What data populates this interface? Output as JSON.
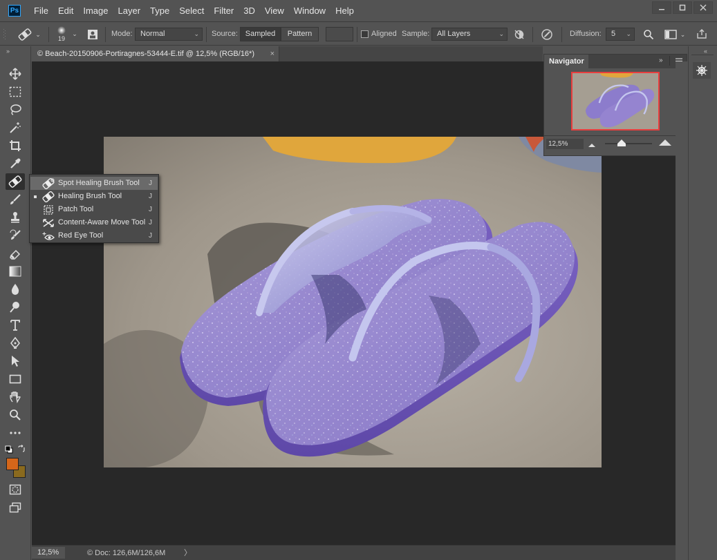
{
  "app": {
    "logo": "Ps"
  },
  "menu": [
    "File",
    "Edit",
    "Image",
    "Layer",
    "Type",
    "Select",
    "Filter",
    "3D",
    "View",
    "Window",
    "Help"
  ],
  "window_controls": [
    "minimize",
    "maximize",
    "close"
  ],
  "options": {
    "brush_size": "19",
    "mode_label": "Mode:",
    "mode_value": "Normal",
    "source_label": "Source:",
    "source_sampled": "Sampled",
    "source_pattern": "Pattern",
    "aligned_label": "Aligned",
    "aligned_checked": false,
    "sample_label": "Sample:",
    "sample_value": "All Layers",
    "diffusion_label": "Diffusion:",
    "diffusion_value": "5"
  },
  "document": {
    "tab_title": "© Beach-20150906-Portiragnes-53444-E.tif @ 12,5% (RGB/16*)",
    "tab_close": "×"
  },
  "status": {
    "zoom": "12,5%",
    "doc_info": "Doc: 126,6M/126,6M",
    "arrow": "〉"
  },
  "navigator": {
    "tab_label": "Navigator",
    "zoom": "12,5%"
  },
  "flyout": [
    {
      "label": "Spot Healing Brush Tool",
      "key": "J",
      "icon": "spot-healing-brush-icon",
      "active": false
    },
    {
      "label": "Healing Brush Tool",
      "key": "J",
      "icon": "healing-brush-icon",
      "active": true
    },
    {
      "label": "Patch Tool",
      "key": "J",
      "icon": "patch-icon",
      "active": false
    },
    {
      "label": "Content-Aware Move Tool",
      "key": "J",
      "icon": "content-aware-move-icon",
      "active": false
    },
    {
      "label": "Red Eye Tool",
      "key": "J",
      "icon": "red-eye-icon",
      "active": false
    }
  ],
  "colors": {
    "foreground": "#d4661a",
    "background": "#8a6a1e",
    "nav_frame": "#e93e3e"
  }
}
